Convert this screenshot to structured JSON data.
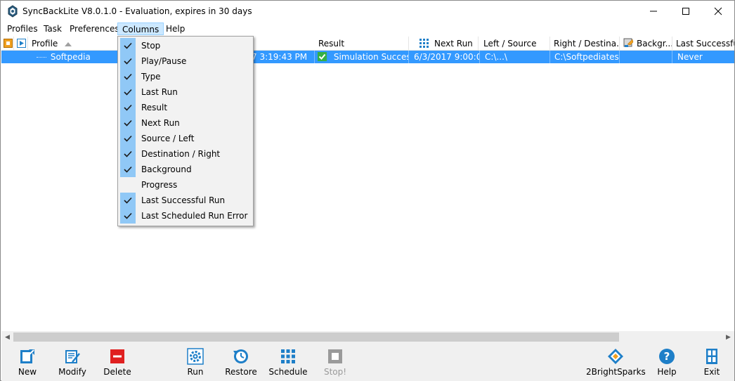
{
  "window": {
    "title": "SyncBackLite V8.0.1.0 - Evaluation, expires in 30 days"
  },
  "menubar": {
    "items": [
      "Profiles",
      "Task",
      "Preferences",
      "Columns",
      "Help"
    ],
    "active": "Columns"
  },
  "grid": {
    "columns": [
      "Profile",
      "Result",
      "Next Run",
      "Left / Source",
      "Right / Destina...",
      "Backgr...",
      "Last Successful R"
    ],
    "row": {
      "profile": "Softpedia",
      "last_run_partial": "7 3:19:43 PM",
      "result": "Simulation Succes...",
      "next_run": "6/3/2017 9:00:0...",
      "left_source": "C:\\...\\",
      "right_destination": "C:\\Softpediatest\\",
      "last_successful": "Never"
    }
  },
  "columns_menu": {
    "items": [
      {
        "label": "Stop",
        "checked": true
      },
      {
        "label": "Play/Pause",
        "checked": true
      },
      {
        "label": "Type",
        "checked": true
      },
      {
        "label": "Last Run",
        "checked": true
      },
      {
        "label": "Result",
        "checked": true
      },
      {
        "label": "Next Run",
        "checked": true
      },
      {
        "label": "Source / Left",
        "checked": true
      },
      {
        "label": "Destination / Right",
        "checked": true
      },
      {
        "label": "Background",
        "checked": true
      },
      {
        "label": "Progress",
        "checked": false
      },
      {
        "label": "Last Successful Run",
        "checked": true
      },
      {
        "label": "Last Scheduled Run Error",
        "checked": true
      }
    ]
  },
  "toolbar": {
    "new": "New",
    "modify": "Modify",
    "delete": "Delete",
    "run": "Run",
    "restore": "Restore",
    "schedule": "Schedule",
    "stop": "Stop!",
    "brand": "2BrightSparks",
    "help": "Help",
    "exit": "Exit"
  },
  "colors": {
    "selection": "#3399ff",
    "menu_check_bg": "#90c8f6",
    "success_green": "#33b045",
    "delete_red": "#e02020",
    "icon_blue": "#1e7fc8"
  }
}
